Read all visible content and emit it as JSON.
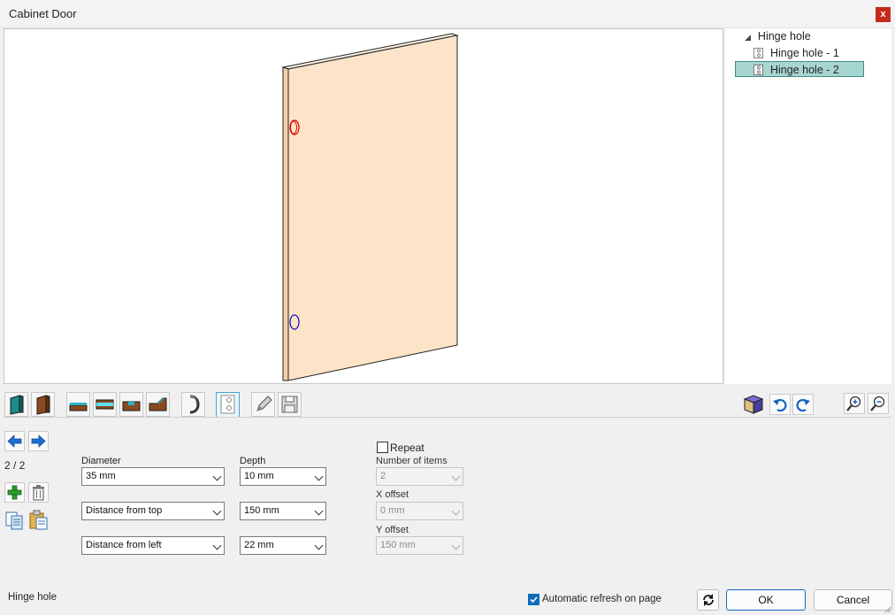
{
  "window": {
    "title": "Cabinet Door",
    "close_glyph": "x"
  },
  "tree": {
    "root": "Hinge hole",
    "items": [
      {
        "label": "Hinge hole - 1",
        "selected": false
      },
      {
        "label": "Hinge hole - 2",
        "selected": true
      }
    ]
  },
  "toolbar": {
    "left_icons": [
      "door-front-icon",
      "door-back-icon",
      "edge-bottom-icon",
      "edge-middle-icon",
      "edge-groove-icon",
      "edge-profile-icon",
      "handle-icon",
      "hinge-hole-icon",
      "pencil-icon",
      "save-icon"
    ],
    "active": "hinge-hole-icon",
    "right_icons": [
      "3d-cube-icon",
      "rotate-left-icon",
      "rotate-right-icon",
      "zoom-in-icon",
      "zoom-out-icon"
    ]
  },
  "nav": {
    "counter": "2 / 2"
  },
  "form": {
    "diameter": {
      "label": "Diameter",
      "value": "35 mm"
    },
    "depth": {
      "label": "Depth",
      "value": "10 mm"
    },
    "vertical_ref": {
      "value": "Distance from top"
    },
    "vertical_dist": {
      "value": "150 mm"
    },
    "horizontal_ref": {
      "value": "Distance from left"
    },
    "horizontal_dist": {
      "value": "22 mm"
    },
    "repeat": {
      "label": "Repeat",
      "checked": false
    },
    "number_of_items": {
      "label": "Number of items",
      "value": "2"
    },
    "x_offset": {
      "label": "X offset",
      "value": "0 mm"
    },
    "y_offset": {
      "label": "Y offset",
      "value": "150 mm"
    }
  },
  "footer": {
    "status": "Hinge hole",
    "auto_refresh": {
      "label": "Automatic refresh on page",
      "checked": true
    },
    "ok": "OK",
    "cancel": "Cancel"
  },
  "colors": {
    "door_face": "#fde3c8",
    "door_edge": "#f3cfa9",
    "hole_selected": "#e00000",
    "hole_other": "#1010c0",
    "tree_selection": "#a7d5cf"
  }
}
